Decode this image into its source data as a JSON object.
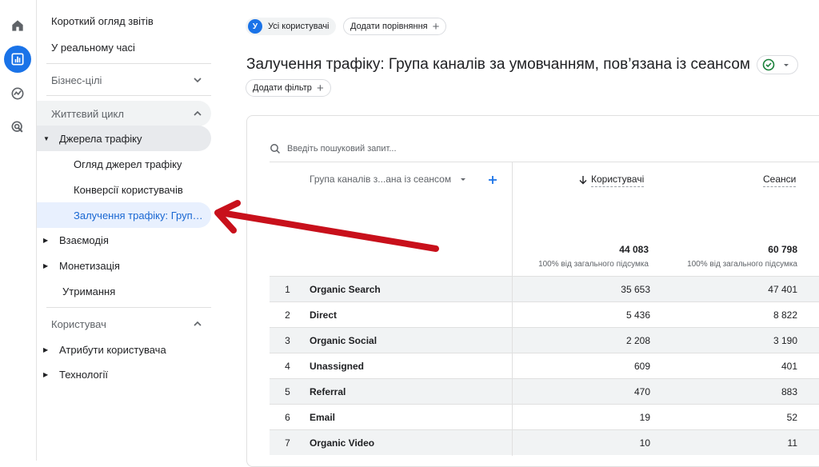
{
  "rail": {
    "icons": [
      "home-icon",
      "reports-icon",
      "explore-icon",
      "advertising-icon"
    ]
  },
  "sidebar": {
    "overview": "Короткий огляд звітів",
    "realtime": "У реальному часі",
    "business_goals": "Бізнес-цілі",
    "lifecycle": "Життєвий цикл",
    "traffic_sources": "Джерела трафіку",
    "sources_overview": "Огляд джерел трафіку",
    "user_conversions": "Конверсії користувачів",
    "traffic_acquisition": "Залучення трафіку: Група ...",
    "engagement": "Взаємодія",
    "monetization": "Монетизація",
    "retention": "Утримання",
    "user_section": "Користувач",
    "user_attributes": "Атрибути користувача",
    "technology": "Технології"
  },
  "header": {
    "user_initial": "У",
    "all_users": "Усі користувачі",
    "add_comparison": "Додати порівняння",
    "title": "Залучення трафіку: Група каналів за умовчанням, пов’язана із сеансом",
    "add_filter": "Додати фільтр"
  },
  "table": {
    "search_placeholder": "Введіть пошуковий запит...",
    "dimension_header": "Група каналів з...ана із сеансом",
    "col_users": "Користувачі",
    "col_sessions": "Сеанси",
    "total_users": "44 083",
    "total_sessions": "60 798",
    "total_users_sub": "100% від загального підсумка",
    "total_sessions_sub": "100% від загального підсумка",
    "rows": [
      {
        "n": "1",
        "name": "Organic Search",
        "users": "35 653",
        "sessions": "47 401"
      },
      {
        "n": "2",
        "name": "Direct",
        "users": "5 436",
        "sessions": "8 822"
      },
      {
        "n": "3",
        "name": "Organic Social",
        "users": "2 208",
        "sessions": "3 190"
      },
      {
        "n": "4",
        "name": "Unassigned",
        "users": "609",
        "sessions": "401"
      },
      {
        "n": "5",
        "name": "Referral",
        "users": "470",
        "sessions": "883"
      },
      {
        "n": "6",
        "name": "Email",
        "users": "19",
        "sessions": "52"
      },
      {
        "n": "7",
        "name": "Organic Video",
        "users": "10",
        "sessions": "11"
      }
    ]
  },
  "colors": {
    "accent": "#1a73e8",
    "annotation_arrow": "#c8101b",
    "selected_text": "#1967d2"
  }
}
